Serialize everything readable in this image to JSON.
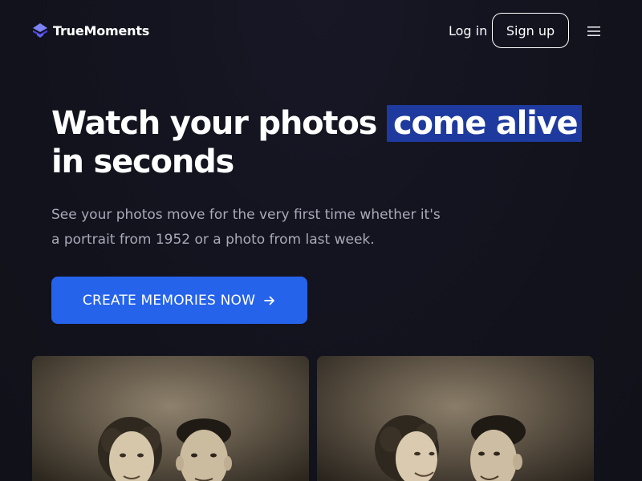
{
  "brand": {
    "name": "TrueMoments",
    "logo_icon": "cube-stack-icon",
    "logo_color": "#6366f1"
  },
  "nav": {
    "login_label": "Log in",
    "signup_label": "Sign up",
    "menu_icon": "hamburger-menu-icon"
  },
  "hero": {
    "title_before": "Watch your photos ",
    "title_highlight": "come alive",
    "title_after": " in seconds",
    "subtitle": "See your photos move for the very first time whether it's a portrait from 1952 or a photo from last week.",
    "cta_label": "CREATE MEMORIES NOW",
    "cta_icon": "arrow-right-icon"
  },
  "photos": [
    {
      "name": "vintage-couple-photo-still",
      "tone": "sepia"
    },
    {
      "name": "vintage-couple-photo-animated",
      "tone": "sepia"
    }
  ],
  "colors": {
    "background": "#13131f",
    "accent": "#2563eb",
    "highlight": "#1f3a9e",
    "subtitle": "#a8aab8"
  }
}
